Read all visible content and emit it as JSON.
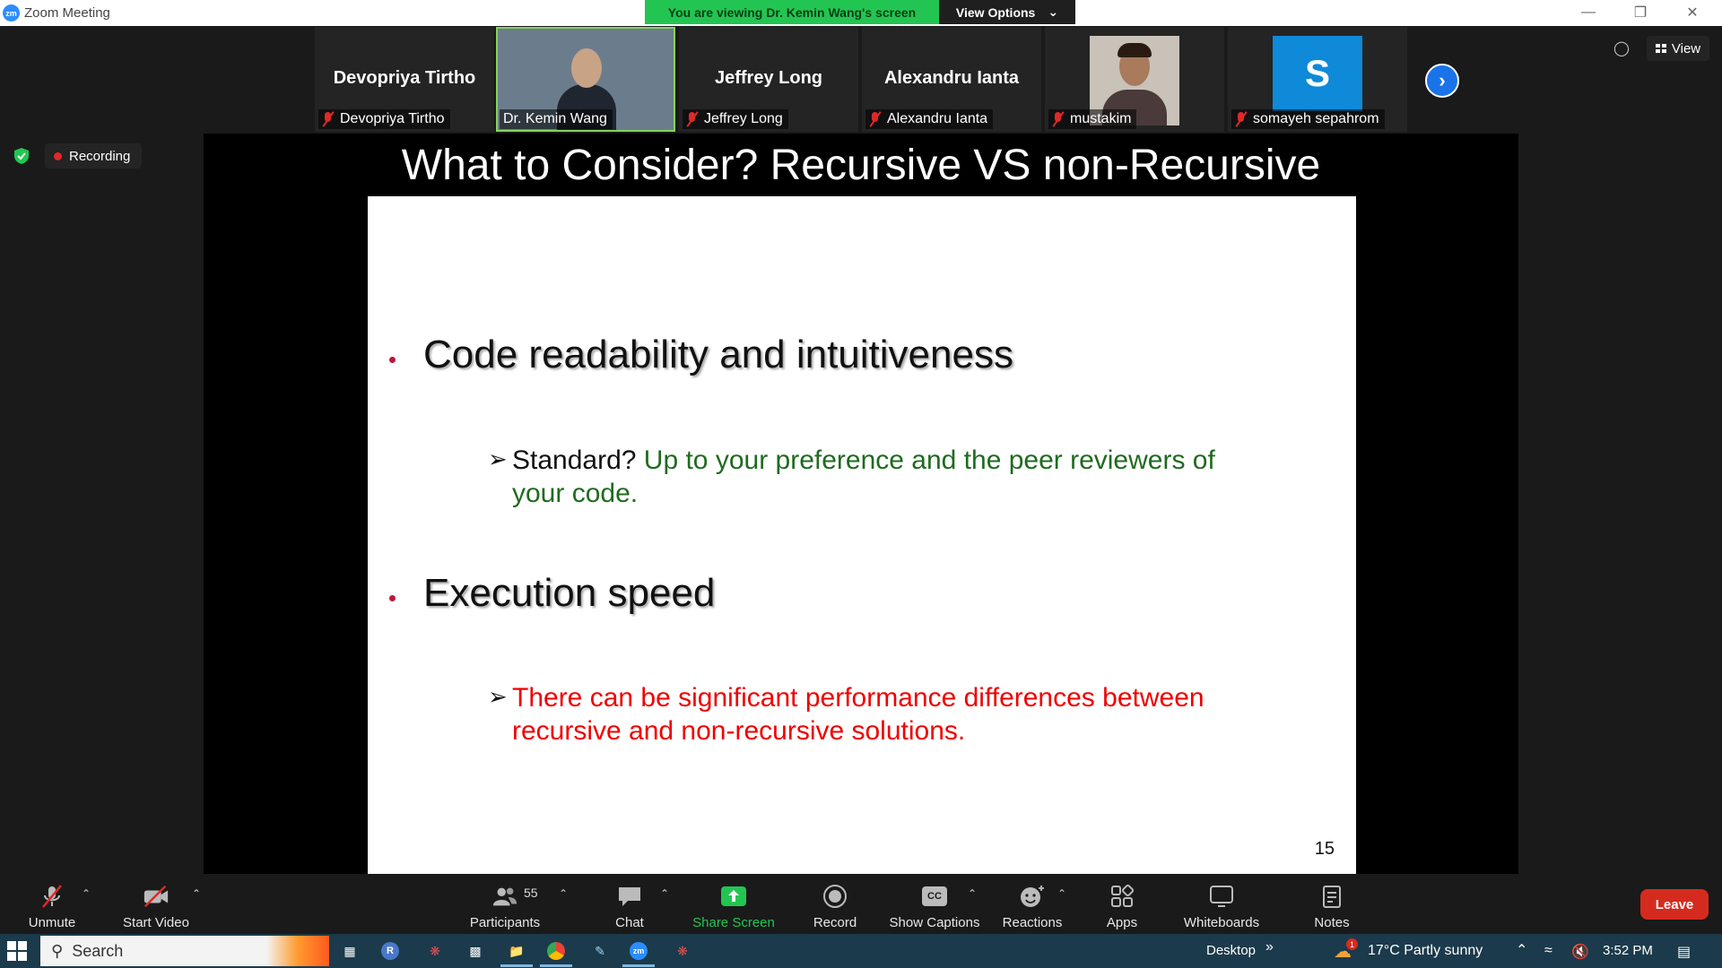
{
  "window": {
    "title": "Zoom Meeting",
    "logo_text": "zm",
    "viewing_banner": "You are viewing Dr. Kemin Wang's screen",
    "view_options": "View Options"
  },
  "participants_strip": {
    "tiles": [
      {
        "big_name": "Devopriya Tirtho",
        "label": "Devopriya Tirtho"
      },
      {
        "big_name": "",
        "label": "Dr. Kemin Wang"
      },
      {
        "big_name": "Jeffrey Long",
        "label": "Jeffrey Long"
      },
      {
        "big_name": "Alexandru Ianta",
        "label": "Alexandru Ianta"
      },
      {
        "big_name": "",
        "label": "mustakim"
      },
      {
        "big_name": "S",
        "label": "somayeh sepahrom"
      }
    ],
    "view_label": "View"
  },
  "recording": {
    "label": "Recording"
  },
  "slide": {
    "title": "What to Consider? Recursive VS non-Recursive",
    "bullet1": "Code readability and intuitiveness",
    "sub1_prefix": "Standard?",
    "sub1_line1": " Up to your preference and the peer reviewers of",
    "sub1_line2": "your code.",
    "bullet2": "Execution speed",
    "sub2_line1": "There can be significant performance differences between",
    "sub2_line2": "recursive and non-recursive solutions.",
    "page_number": "15"
  },
  "toolbar": {
    "unmute": "Unmute",
    "start_video": "Start Video",
    "participants": "Participants",
    "participants_count": "55",
    "chat": "Chat",
    "share_screen": "Share Screen",
    "record": "Record",
    "show_captions": "Show Captions",
    "captions_icon": "CC",
    "reactions": "Reactions",
    "apps": "Apps",
    "whiteboards": "Whiteboards",
    "notes": "Notes",
    "leave": "Leave"
  },
  "taskbar": {
    "search": "Search",
    "desktop": "Desktop",
    "weather": "17°C  Partly sunny",
    "time": "3:52 PM",
    "badge": "1"
  },
  "colors": {
    "banner_green": "#23c552",
    "leave_red": "#d52b1e",
    "slide_green_text": "#1f6b1f",
    "slide_red_text": "#f00000",
    "bullet_red": "#c0143c"
  }
}
